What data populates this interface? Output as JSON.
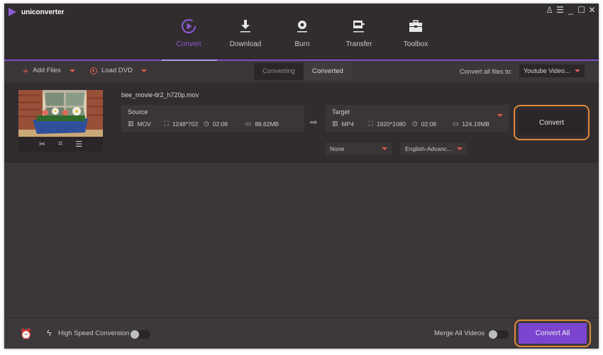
{
  "app": {
    "name": "uniconverter",
    "accent": "#8c5bd6",
    "highlight": "#e08a3c"
  },
  "window_controls": [
    {
      "name": "user-icon",
      "glyph": "♙"
    },
    {
      "name": "menu-icon",
      "glyph": "☰"
    },
    {
      "name": "minimize-icon",
      "glyph": "_"
    },
    {
      "name": "maximize-icon",
      "glyph": "☐"
    },
    {
      "name": "close-icon",
      "glyph": "✕"
    }
  ],
  "nav": [
    {
      "label": "Convert",
      "icon": "convert-icon",
      "active": true
    },
    {
      "label": "Download",
      "icon": "download-icon",
      "active": false
    },
    {
      "label": "Burn",
      "icon": "burn-icon",
      "active": false
    },
    {
      "label": "Transfer",
      "icon": "transfer-icon",
      "active": false
    },
    {
      "label": "Toolbox",
      "icon": "toolbox-icon",
      "active": false
    }
  ],
  "toolbar": {
    "add_files": "Add Files",
    "load_dvd": "Load DVD",
    "tabs": [
      "Converting",
      "Converted"
    ],
    "convert_all_label": "Convert all files to:",
    "convert_all_value": "Youtube Video..."
  },
  "file": {
    "name": "bee_movie-tlr2_h720p.mov",
    "source": {
      "title": "Source",
      "format": "MOV",
      "resolution": "1248*702",
      "duration": "02:08",
      "size": "88.62MB"
    },
    "target": {
      "title": "Target",
      "format": "MP4",
      "resolution": "1920*1080",
      "duration": "02:08",
      "size": "124.19MB"
    },
    "subtitle": "None",
    "audio": "English-Advanc...",
    "convert_label": "Convert"
  },
  "footer": {
    "high_speed_label": "High Speed Conversion",
    "high_speed_on": false,
    "merge_label": "Merge All Videos",
    "merge_on": false,
    "convert_all_button": "Convert All"
  }
}
